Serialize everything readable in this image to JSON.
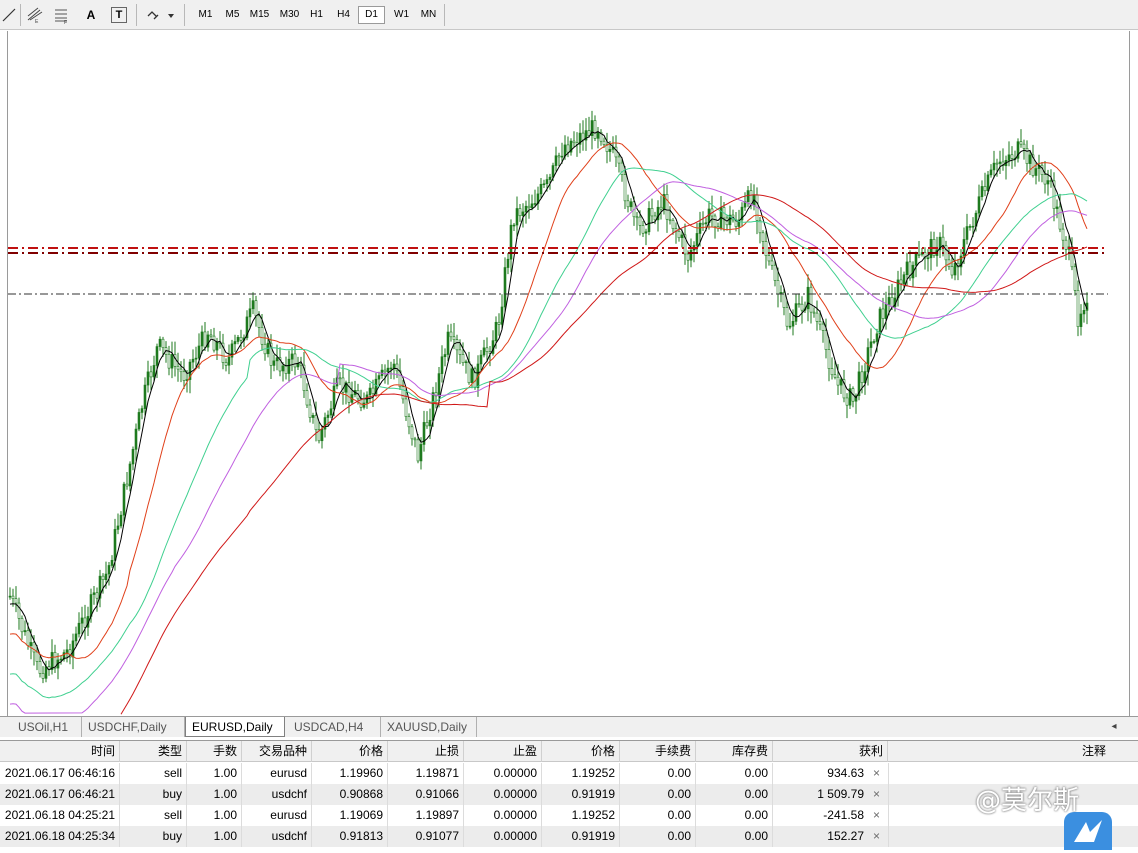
{
  "toolbar": {
    "tool_icons": [
      "line-tool-icon",
      "fibonacci-icon",
      "fibonacci-fan-icon",
      "text-tool-icon",
      "text-label-icon",
      "arrows-icon"
    ],
    "text_tool_label": "A",
    "text_label_label": "T",
    "timeframes": [
      "M1",
      "M5",
      "M15",
      "M30",
      "H1",
      "H4",
      "D1",
      "W1",
      "MN"
    ],
    "active_timeframe": "D1"
  },
  "chart": {
    "symbol": "EURUSD",
    "timeframe": "Daily",
    "bull_color": "#1e7a1e",
    "ma_colors": [
      "#000000",
      "#e0401a",
      "#40d090",
      "#c060e0",
      "#d01818"
    ],
    "level_colors": [
      "#c01010",
      "#800000",
      "#303030"
    ]
  },
  "tabs": {
    "items": [
      "USOil,H1",
      "USDCHF,Daily",
      "EURUSD,Daily",
      "USDCAD,H4",
      "XAUUSD,Daily"
    ],
    "active": "EURUSD,Daily",
    "scroll_left": "◂"
  },
  "terminal": {
    "columns": [
      "时间",
      "类型",
      "手数",
      "交易品种",
      "价格",
      "止损",
      "止盈",
      "价格",
      "手续费",
      "库存费",
      "获利",
      "注释"
    ],
    "rows": [
      [
        "2021.06.17 06:46:16",
        "sell",
        "1.00",
        "eurusd",
        "1.19960",
        "1.19871",
        "0.00000",
        "1.19252",
        "0.00",
        "0.00",
        "934.63"
      ],
      [
        "2021.06.17 06:46:21",
        "buy",
        "1.00",
        "usdchf",
        "0.90868",
        "0.91066",
        "0.00000",
        "0.91919",
        "0.00",
        "0.00",
        "1 509.79"
      ],
      [
        "2021.06.18 04:25:21",
        "sell",
        "1.00",
        "eurusd",
        "1.19069",
        "1.19897",
        "0.00000",
        "1.19252",
        "0.00",
        "0.00",
        "-241.58"
      ],
      [
        "2021.06.18 04:25:34",
        "buy",
        "1.00",
        "usdchf",
        "0.91813",
        "0.91077",
        "0.00000",
        "0.91919",
        "0.00",
        "0.00",
        "152.27"
      ]
    ],
    "close_glyph": "×"
  },
  "watermark": "@莫尔斯"
}
